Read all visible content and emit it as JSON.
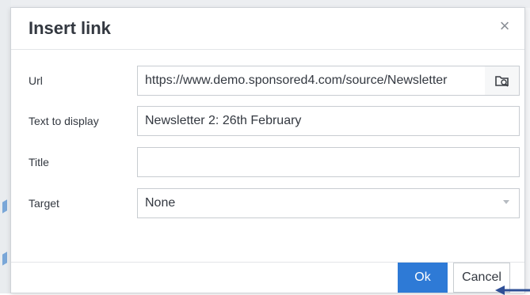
{
  "dialog": {
    "title": "Insert link",
    "close_glyph": "×"
  },
  "fields": {
    "url": {
      "label": "Url",
      "value": "https://www.demo.sponsored4.com/source/Newsletter",
      "browse_icon": "folder-search-icon"
    },
    "text_to_display": {
      "label": "Text to display",
      "value": "Newsletter 2: 26th February"
    },
    "title": {
      "label": "Title",
      "value": ""
    },
    "target": {
      "label": "Target",
      "selected": "None"
    }
  },
  "footer": {
    "ok_label": "Ok",
    "cancel_label": "Cancel"
  },
  "colors": {
    "primary": "#2e7ad6",
    "arrow": "#2f4f96"
  }
}
